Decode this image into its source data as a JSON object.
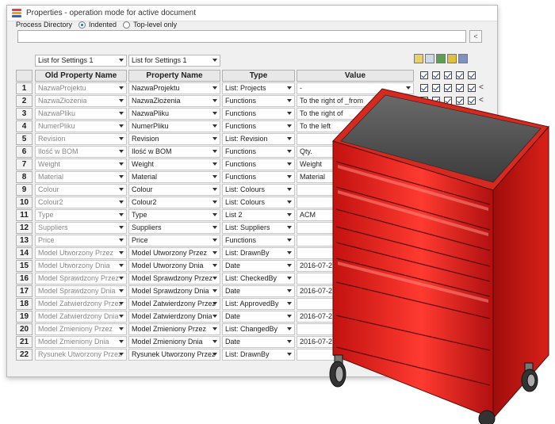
{
  "window": {
    "title": "Properties - operation mode for active document"
  },
  "process": {
    "label": "Process Directory",
    "option_indented": "Indented",
    "option_top_level": "Top-level only",
    "selected": "Indented",
    "path_value": "",
    "browse_label": "<"
  },
  "lists": {
    "left": "List for Settings 1",
    "right": "List for Settings 1"
  },
  "columns": [
    "Old Property Name",
    "Property Name",
    "Type",
    "Value"
  ],
  "rows": [
    {
      "n": "1",
      "old": "NazwaProjektu",
      "prop": "NazwaProjektu",
      "type": "List: Projects",
      "value": "-"
    },
    {
      "n": "2",
      "old": "NazwaZłożenia",
      "prop": "NazwaZłożenia",
      "type": "Functions",
      "value": "To the right of _from"
    },
    {
      "n": "3",
      "old": "NazwaPliku",
      "prop": "NazwaPliku",
      "type": "Functions",
      "value": "To the right of"
    },
    {
      "n": "4",
      "old": "NumerPliku",
      "prop": "NumerPliku",
      "type": "Functions",
      "value": "To the left"
    },
    {
      "n": "5",
      "old": "Revision",
      "prop": "Revision",
      "type": "List: Revision",
      "value": ""
    },
    {
      "n": "6",
      "old": "Ilość w BOM",
      "prop": "Ilość w BOM",
      "type": "Functions",
      "value": "Qty."
    },
    {
      "n": "7",
      "old": "Weight",
      "prop": "Weight",
      "type": "Functions",
      "value": "Weight"
    },
    {
      "n": "8",
      "old": "Material",
      "prop": "Material",
      "type": "Functions",
      "value": "Material"
    },
    {
      "n": "9",
      "old": "Colour",
      "prop": "Colour",
      "type": "List: Colours",
      "value": ""
    },
    {
      "n": "10",
      "old": "Colour2",
      "prop": "Colour2",
      "type": "List: Colours",
      "value": ""
    },
    {
      "n": "11",
      "old": "Type",
      "prop": "Type",
      "type": "List 2",
      "value": "ACM"
    },
    {
      "n": "12",
      "old": "Suppliers",
      "prop": "Suppliers",
      "type": "List: Suppliers",
      "value": ""
    },
    {
      "n": "13",
      "old": "Price",
      "prop": "Price",
      "type": "Functions",
      "value": ""
    },
    {
      "n": "14",
      "old": "Model Utworzony Przez",
      "prop": "Model Utworzony Przez",
      "type": "List: DrawnBy",
      "value": ""
    },
    {
      "n": "15",
      "old": "Model Utworzony Dnia",
      "prop": "Model Utworzony Dnia",
      "type": "Date",
      "value": "2016-07-2"
    },
    {
      "n": "16",
      "old": "Model Sprawdzony Przez",
      "prop": "Model Sprawdzony Przez",
      "type": "List: CheckedBy",
      "value": ""
    },
    {
      "n": "17",
      "old": "Model Sprawdzony Dnia",
      "prop": "Model Sprawdzony Dnia",
      "type": "Date",
      "value": "2016-07-2"
    },
    {
      "n": "18",
      "old": "Model Zatwierdzony Przez",
      "prop": "Model Zatwierdzony Przez",
      "type": "List: ApprovedBy",
      "value": ""
    },
    {
      "n": "19",
      "old": "Model Zatwierdzony Dnia",
      "prop": "Model Zatwierdzony Dnia",
      "type": "Date",
      "value": "2016-07-2"
    },
    {
      "n": "20",
      "old": "Model Zmieniony Przez",
      "prop": "Model Zmieniony Przez",
      "type": "List: ChangedBy",
      "value": ""
    },
    {
      "n": "21",
      "old": "Model Zmieniony Dnia",
      "prop": "Model Zmieniony Dnia",
      "type": "Date",
      "value": "2016-07-2"
    },
    {
      "n": "22",
      "old": "Rysunek Utworzony Przez",
      "prop": "Rysunek Utworzony Przez",
      "type": "List: DrawnBy",
      "value": ""
    }
  ],
  "row_arrow": "<",
  "toolbar_icons": [
    "gear-icon",
    "copy-icon",
    "excel-icon",
    "settings-icon",
    "grid-icon"
  ],
  "colors": {
    "cabinet_red": "#e0201c",
    "cabinet_top": "#555555",
    "checkbox_mark": "#1a3f8a"
  }
}
